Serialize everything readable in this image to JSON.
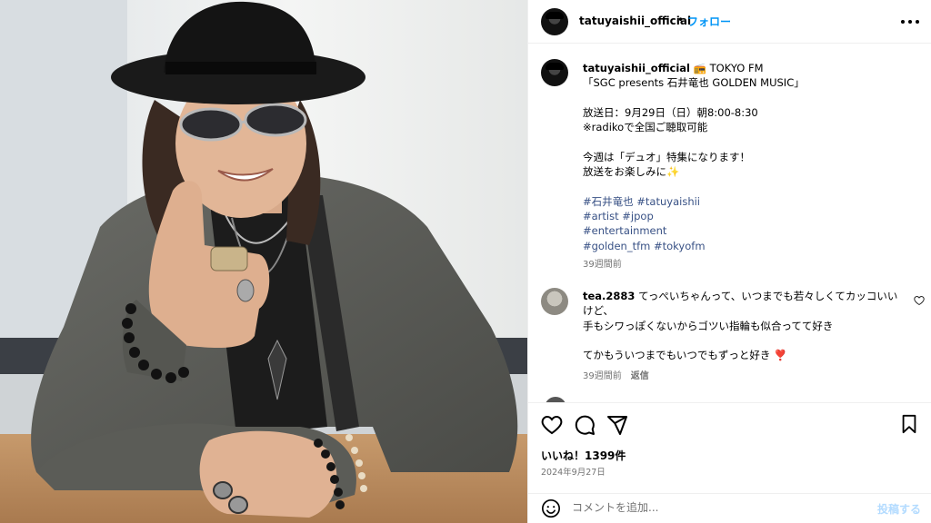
{
  "post": {
    "username": "tatuyaishii_official",
    "follow_label": "フォロー",
    "separator": "•"
  },
  "caption": {
    "username": "tatuyaishii_official",
    "radio_icon": "📻",
    "line1": " TOKYO FM",
    "body": "「SGC presents 石井竜也 GOLDEN MUSIC」\n\n放送日：9月29日（日）朝8:00-8:30\n※radikoで全国ご聴取可能\n\n今週は「デュオ」特集になります！\n放送をお楽しみに",
    "sparkle": "✨",
    "hashtags_line1": "#石井竜也 #tatuyaishii",
    "hashtags_line2": "#artist #jpop",
    "hashtags_line3": "#entertainment",
    "hashtags_line4": "#golden_tfm #tokyofm",
    "time": "39週間前"
  },
  "comment": {
    "username": "tea.2883",
    "text": " てっぺいちゃんって、いつまでも若々しくてカッコいいけど、\n手もシワっぽくないからゴツい指輪も似合ってて好き\n\nてかもういつまでもいつでもずっと好き",
    "heart_emoji": "❣️",
    "time": "39週間前",
    "reply_label": "返信"
  },
  "engagement": {
    "likes": "いいね！1399件",
    "date": "2024年9月27日"
  },
  "composer": {
    "placeholder": "コメントを追加...",
    "post_label": "投稿する"
  },
  "icons": {
    "like": "heart-outline-icon",
    "comment": "comment-bubble-icon",
    "share": "paper-plane-icon",
    "save": "bookmark-icon",
    "emoji": "smiley-icon",
    "more": "more-dots-icon"
  },
  "colors": {
    "link_blue": "#0095f6",
    "hashtag": "#385185",
    "muted": "#737373",
    "post_disabled": "#b3dbff"
  }
}
